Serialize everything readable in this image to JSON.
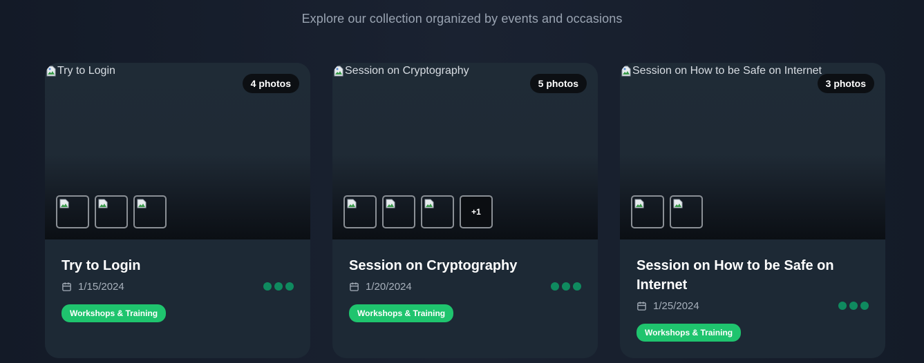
{
  "header": {
    "subtitle": "Explore our collection organized by events and occasions"
  },
  "albums": [
    {
      "image_alt": "Try to Login",
      "photo_count": "4 photos",
      "title": "Try to Login",
      "date": "1/15/2024",
      "category": "Workshops & Training",
      "thumbnails_shown": 3,
      "more_label": ""
    },
    {
      "image_alt": "Session on Cryptography",
      "photo_count": "5 photos",
      "title": "Session on Cryptography",
      "date": "1/20/2024",
      "category": "Workshops & Training",
      "thumbnails_shown": 3,
      "more_label": "+1"
    },
    {
      "image_alt": "Session on How to be Safe on Internet",
      "photo_count": "3 photos",
      "title": "Session on How to be Safe on Internet",
      "date": "1/25/2024",
      "category": "Workshops & Training",
      "thumbnails_shown": 2,
      "more_label": ""
    }
  ],
  "colors": {
    "tag": "#1fc46e",
    "dot": "#0f8a5f",
    "badge": "#0c0f13",
    "card": "#1d2935"
  },
  "icons": {
    "date": "calendar-icon",
    "menu": "more-dots-icon",
    "broken_image": "broken-image-icon"
  }
}
